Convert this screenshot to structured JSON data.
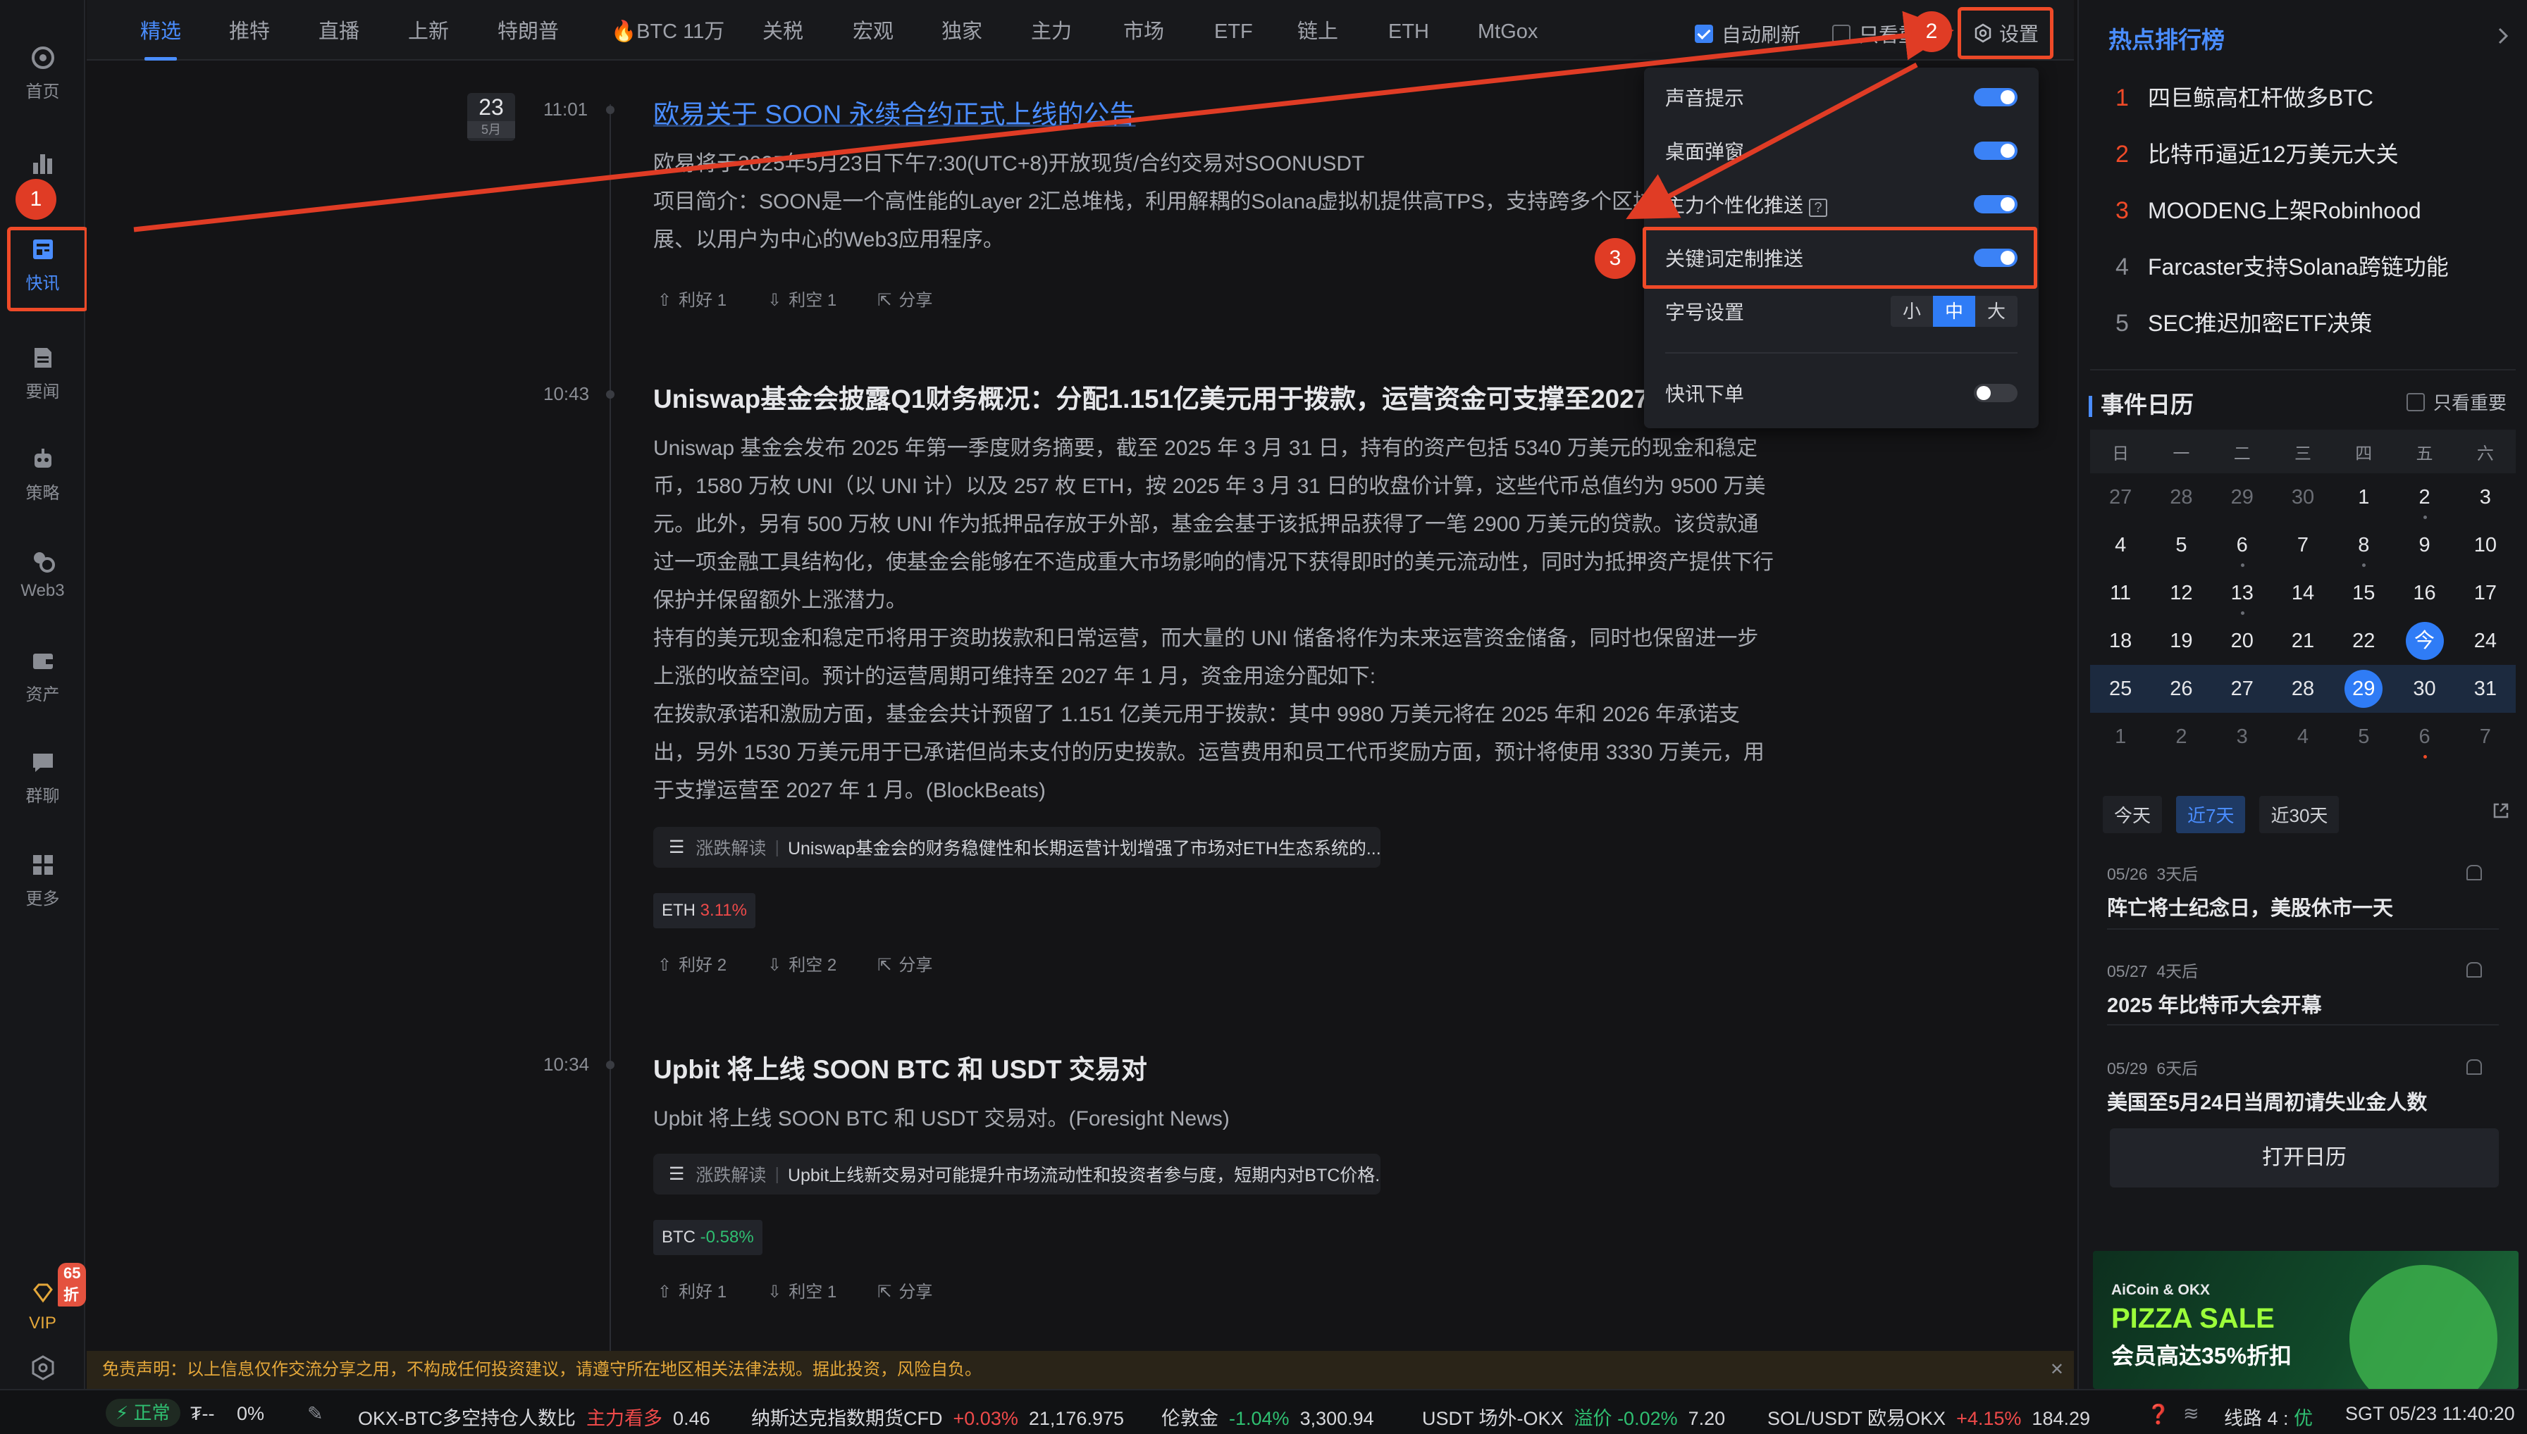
{
  "sidebar": {
    "items": [
      {
        "label": "首页",
        "icon": "home-icon"
      },
      {
        "label": "",
        "icon": "chart-bars-icon"
      },
      {
        "label": "快讯",
        "icon": "newsflash-icon",
        "active": true
      },
      {
        "label": "要闻",
        "icon": "news-icon"
      },
      {
        "label": "策略",
        "icon": "robot-icon"
      },
      {
        "label": "Web3",
        "icon": "web3-icon"
      },
      {
        "label": "资产",
        "icon": "wallet-icon"
      },
      {
        "label": "群聊",
        "icon": "chat-icon"
      },
      {
        "label": "更多",
        "icon": "grid-icon"
      }
    ],
    "vip_label": "VIP",
    "vip_badge": "65折"
  },
  "tabs": [
    "精选",
    "推特",
    "直播",
    "上新",
    "特朗普",
    "🔥BTC 11万",
    "关税",
    "宏观",
    "独家",
    "主力",
    "市场",
    "ETF",
    "链上",
    "ETH",
    "MtGox"
  ],
  "topbar": {
    "auto_refresh": "自动刷新",
    "only_important": "只看重",
    "settings": "设置"
  },
  "feed": {
    "date_day": "23",
    "date_month": "5月",
    "items": [
      {
        "time": "11:01",
        "title": "欧易关于 SOON 永续合约正式上线的公告",
        "body": [
          "欧易将于2025年5月23日下午7:30(UTC+8)开放现货/合约交易对SOONUSDT",
          "项目简介：SOON是一个高性能的Layer 2汇总堆栈，利用解耦的Solana虚拟机提供高TPS，支持跨多个区块链的可扩展、以用户为中心的Web3应用程序。"
        ],
        "bull": "利好 1",
        "bear": "利空 1",
        "share": "分享"
      },
      {
        "time": "10:43",
        "title": "Uniswap基金会披露Q1财务概况：分配1.151亿美元用于拨款，运营资金可支撑至2027年",
        "body": [
          "Uniswap 基金会发布 2025 年第一季度财务摘要，截至 2025 年 3 月 31 日，持有的资产包括 5340 万美元的现金和稳定币，1580 万枚 UNI（以 UNI 计）以及 257 枚 ETH，按 2025 年 3 月 31 日的收盘价计算，这些代币总值约为 9500 万美元。此外，另有 500 万枚 UNI 作为抵押品存放于外部，基金会基于该抵押品获得了一笔 2900 万美元的贷款。该贷款通过一项金融工具结构化，使基金会能够在不造成重大市场影响的情况下获得即时的美元流动性，同时为抵押资产提供下行保护并保留额外上涨潜力。",
          "持有的美元现金和稳定币将用于资助拨款和日常运营，而大量的 UNI 储备将作为未来运营资金储备，同时也保留进一步上涨的收益空间。预计的运营周期可维持至 2027 年 1 月，资金用途分配如下:",
          "在拨款承诺和激励方面，基金会共计预留了 1.151 亿美元用于拨款：其中 9980 万美元将在 2025 年和 2026 年承诺支出，另外 1530 万美元用于已承诺但尚未支付的历史拨款。运营费用和员工代币奖励方面，预计将使用 3330 万美元，用于支撑运营至 2027 年 1 月。(BlockBeats)"
        ],
        "analysis_label": "涨跌解读",
        "analysis": "Uniswap基金会的财务稳健性和长期运营计划增强了市场对ETH生态系统的...",
        "coin": "ETH",
        "coin_change": "3.11%",
        "bull": "利好 2",
        "bear": "利空 2",
        "share": "分享"
      },
      {
        "time": "10:34",
        "title": "Upbit 将上线 SOON BTC 和 USDT 交易对",
        "body": [
          "Upbit 将上线 SOON BTC 和 USDT 交易对。(Foresight News)"
        ],
        "analysis_label": "涨跌解读",
        "analysis": "Upbit上线新交易对可能提升市场流动性和投资者参与度，短期内对BTC价格...",
        "coin": "BTC",
        "coin_change": "-0.58%",
        "bull": "利好 1",
        "bear": "利空 1",
        "share": "分享"
      }
    ]
  },
  "settings_popup": {
    "rows": [
      {
        "label": "声音提示",
        "on": true
      },
      {
        "label": "桌面弹窗",
        "on": true
      },
      {
        "label": "主力个性化推送",
        "on": true
      },
      {
        "label": "关键词定制推送",
        "on": true
      }
    ],
    "font_label": "字号设置",
    "font_sizes": [
      "小",
      "中",
      "大"
    ],
    "font_selected": "中",
    "order_label": "快讯下单",
    "order_on": false
  },
  "callouts": [
    "1",
    "2",
    "3"
  ],
  "hot_ranking": {
    "title": "热点排行榜",
    "items": [
      "四巨鲸高杠杆做多BTC",
      "比特币逼近12万美元大关",
      "MOODENG上架Robinhood",
      "Farcaster支持Solana跨链功能",
      "SEC推迟加密ETF决策"
    ],
    "ranks": [
      "1",
      "2",
      "3",
      "4",
      "5"
    ]
  },
  "calendar": {
    "title": "事件日历",
    "only_important": "只看重要",
    "weekdays": [
      "日",
      "一",
      "二",
      "三",
      "四",
      "五",
      "六"
    ],
    "weeks": [
      [
        "27",
        "28",
        "29",
        "30",
        "1",
        "2",
        "3"
      ],
      [
        "4",
        "5",
        "6",
        "7",
        "8",
        "9",
        "10"
      ],
      [
        "11",
        "12",
        "13",
        "14",
        "15",
        "16",
        "17"
      ],
      [
        "18",
        "19",
        "20",
        "21",
        "22",
        "今",
        "24"
      ],
      [
        "25",
        "26",
        "27",
        "28",
        "29",
        "30",
        "31"
      ],
      [
        "1",
        "2",
        "3",
        "4",
        "5",
        "6",
        "7"
      ]
    ],
    "ranges": [
      "今天",
      "近7天",
      "近30天"
    ],
    "events": [
      {
        "date": "05/26",
        "rel": "3天后",
        "name": "阵亡将士纪念日，美股休市一天"
      },
      {
        "date": "05/27",
        "rel": "4天后",
        "name": "2025 年比特币大会开幕"
      },
      {
        "date": "05/29",
        "rel": "6天后",
        "name": "美国至5月24日当周初请失业金人数"
      }
    ],
    "open_button": "打开日历"
  },
  "ad": {
    "line1": "AiCoin & OKX",
    "line2": "PIZZA SALE",
    "line3": "会员高达35%折扣"
  },
  "disclaimer": "免责声明：以上信息仅作交流分享之用，不构成任何投资建议，请遵守所在地区相关法律法规。据此投资，风险自负。",
  "statusbar": {
    "status": "正常",
    "asset": "₮--",
    "pct": "0%",
    "t1_name": "OKX-BTC多空持仓人数比",
    "t1_tag": "主力看多",
    "t1_val": "0.46",
    "t2_name": "纳斯达克指数期货CFD",
    "t2_chg": "+0.03%",
    "t2_val": "21,176.975",
    "t3_name": "伦敦金",
    "t3_chg": "-1.04%",
    "t3_val": "3,300.94",
    "t4_name": "USDT 场外-OKX",
    "t4_tag": "溢价",
    "t4_chg": "-0.02%",
    "t4_val": "7.20",
    "t5_name": "SOL/USDT 欧易OKX",
    "t5_chg": "+4.15%",
    "t5_val": "184.29",
    "line": "线路 4 :",
    "line_q": "优",
    "clock": "SGT 05/23 11:40:20"
  }
}
